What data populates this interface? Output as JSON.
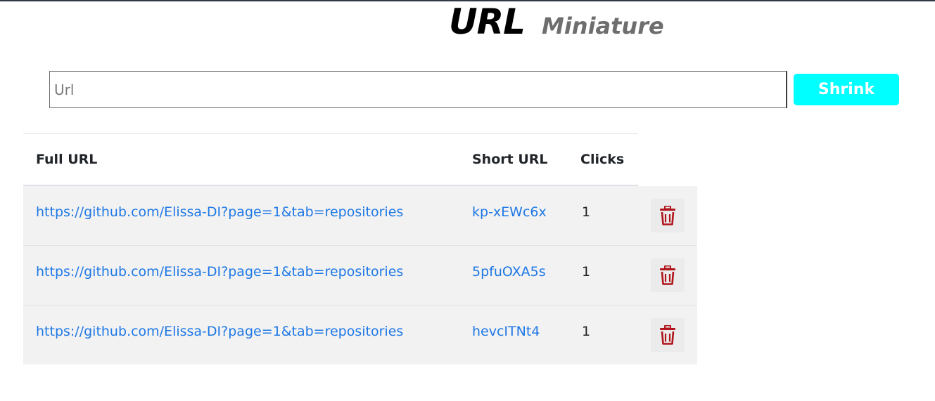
{
  "brand": {
    "main": "URL",
    "sub": "Miniature"
  },
  "form": {
    "placeholder": "Url",
    "value": "",
    "submit_label": "Shrink"
  },
  "table": {
    "headers": {
      "full": "Full URL",
      "short": "Short URL",
      "clicks": "Clicks"
    },
    "rows": [
      {
        "full": "https://github.com/Elissa-DI?page=1&tab=repositories",
        "short": "kp-xEWc6x",
        "clicks": "1"
      },
      {
        "full": "https://github.com/Elissa-DI?page=1&tab=repositories",
        "short": "5pfuOXA5s",
        "clicks": "1"
      },
      {
        "full": "https://github.com/Elissa-DI?page=1&tab=repositories",
        "short": "hevcITNt4",
        "clicks": "1"
      }
    ]
  },
  "colors": {
    "accent": "#00ffff",
    "link": "#1e78e6",
    "delete_icon": "#b0151c",
    "row_background": "#f2f2f2"
  },
  "icons": {
    "delete": "trash-icon"
  }
}
